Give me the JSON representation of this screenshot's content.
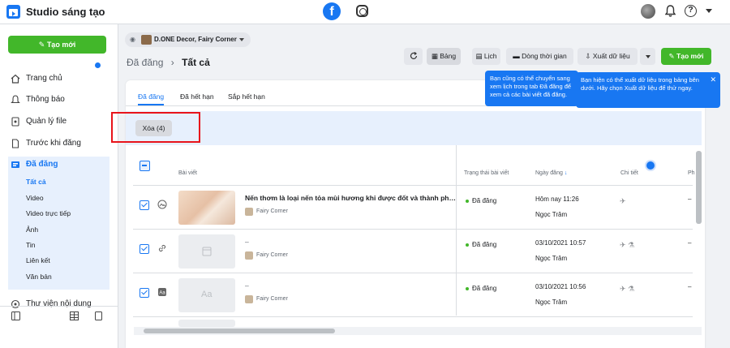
{
  "app": {
    "title": "Studio sáng tạo"
  },
  "sidebar": {
    "create_label": "Tạo mới",
    "items": [
      {
        "label": "Trang chủ"
      },
      {
        "label": "Thông báo"
      },
      {
        "label": "Quản lý file"
      },
      {
        "label": "Trước khi đăng"
      },
      {
        "label": "Đã đăng"
      }
    ],
    "sub_items": [
      "Tất cả",
      "Video",
      "Video trực tiếp",
      "Ảnh",
      "Tin",
      "Liên kết",
      "Văn bản"
    ],
    "library_label": "Thư viện nội dung"
  },
  "header": {
    "page_selector": "D.ONE Decor, Fairy Corner",
    "breadcrumb_parent": "Đã đăng",
    "breadcrumb_current": "Tất cả",
    "toolbar": {
      "feed": "Bảng",
      "calendar": "Lịch",
      "timeline": "Dòng thời gian",
      "export": "Xuất dữ liệu",
      "create": "Tạo mới"
    }
  },
  "tabs": [
    "Đã đăng",
    "Đã hết hạn",
    "Sắp hết hạn"
  ],
  "bulk": {
    "delete_label": "Xóa (4)"
  },
  "tooltips": {
    "calendar": "Bạn cũng có thể chuyển sang xem lịch trong tab Đã đăng để xem cả các bài viết đã đăng.",
    "export": "Bạn hiện có thể xuất dữ liệu trong bảng bên dưới. Hãy chọn Xuất dữ liệu để thử ngay."
  },
  "table": {
    "headers": {
      "post": "Bài viết",
      "status": "Trạng thái bài viết",
      "date": "Ngày đăng",
      "detail": "Chi tiết",
      "extra": "Ph"
    },
    "rows": [
      {
        "title": "Nến thơm là loại nến tỏa mùi hương khi được đốt và thành phần ...",
        "page": "Fairy Corner",
        "status": "Đã đăng",
        "date": "Hôm nay 11:26",
        "author": "Ngọc Trâm",
        "extra": "–"
      },
      {
        "title": "–",
        "page": "Fairy Corner",
        "status": "Đã đăng",
        "date": "03/10/2021 10:57",
        "author": "Ngọc Trâm",
        "extra": "–"
      },
      {
        "title": "–",
        "page": "Fairy Corner",
        "status": "Đã đăng",
        "date": "03/10/2021 10:56",
        "author": "Ngọc Trâm",
        "extra": "–"
      }
    ]
  },
  "colors": {
    "primary": "#1877f2",
    "green": "#42b72a",
    "highlight": "#e8141b"
  }
}
